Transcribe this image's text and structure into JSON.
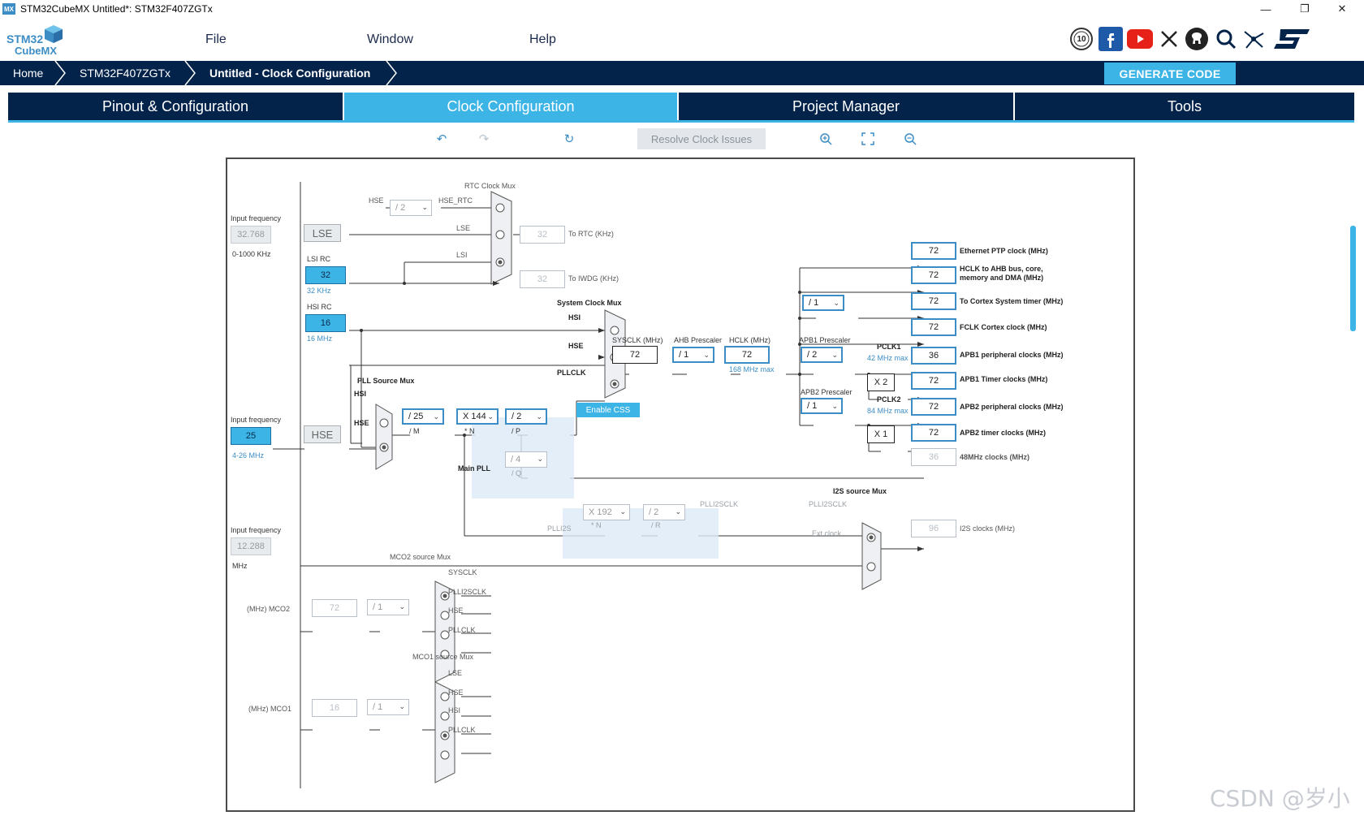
{
  "window": {
    "title": "STM32CubeMX Untitled*: STM32F407ZGTx",
    "app_icon": "MX"
  },
  "logo": {
    "line1": "STM32",
    "line2": "CubeMX"
  },
  "menu": {
    "file": "File",
    "window": "Window",
    "help": "Help"
  },
  "social_icons": [
    "anniversary-icon",
    "facebook-icon",
    "youtube-icon",
    "x-icon",
    "github-icon",
    "search-community-icon",
    "network-icon",
    "st-logo-icon"
  ],
  "anniversary_text": "10",
  "breadcrumb": {
    "home": "Home",
    "device": "STM32F407ZGTx",
    "page": "Untitled - Clock Configuration"
  },
  "generate_button": "GENERATE CODE",
  "tabs": {
    "pinout": "Pinout & Configuration",
    "clock": "Clock Configuration",
    "project": "Project Manager",
    "tools": "Tools"
  },
  "toolbar": {
    "resolve": "Resolve Clock Issues"
  },
  "clock": {
    "lse_input_label": "Input frequency",
    "lse_input_value": "32.768",
    "lse_range": "0-1000 KHz",
    "lse": "LSE",
    "lsi_rc": "LSI RC",
    "lsi_value": "32",
    "lsi_khz": "32 KHz",
    "hsi_rc": "HSI RC",
    "hsi_value": "16",
    "hsi_mhz": "16 MHz",
    "hse_input_label": "Input frequency",
    "hse_input_value": "25",
    "hse_range": "4-26 MHz",
    "hse": "HSE",
    "i2s_input_label": "Input frequency",
    "i2s_input_value": "12.288",
    "i2s_unit": "MHz",
    "rtc_mux": "RTC Clock Mux",
    "hse_rtc_in": "HSE",
    "hse_rtc_div": "/ 2",
    "hse_rtc": "HSE_RTC",
    "lse_line": "LSE",
    "lsi_line": "LSI",
    "rtc_value": "32",
    "to_rtc": "To RTC (KHz)",
    "iwdg_value": "32",
    "to_iwdg": "To IWDG (KHz)",
    "sys_mux": "System Clock Mux",
    "sys_hsi": "HSI",
    "sys_hse": "HSE",
    "sys_pllclk": "PLLCLK",
    "enable_css": "Enable CSS",
    "pll_src_mux": "PLL Source Mux",
    "pll_hsi": "HSI",
    "pll_hse": "HSE",
    "pll_m": "/ 25",
    "pll_m_label": "/ M",
    "pll_n": "X 144",
    "pll_n_label": "* N",
    "pll_p": "/ 2",
    "pll_p_label": "/ P",
    "pll_q": "/ 4",
    "pll_q_label": "/ Q",
    "main_pll": "Main PLL",
    "sysclk_label": "SYSCLK (MHz)",
    "sysclk": "72",
    "ahb_label": "AHB Prescaler",
    "ahb": "/ 1",
    "hclk_label": "HCLK (MHz)",
    "hclk": "72",
    "hclk_max": "168 MHz max",
    "apb1_label": "APB1 Prescaler",
    "apb1": "/ 2",
    "pclk1": "PCLK1",
    "pclk1_max": "42 MHz max",
    "apb2_label": "APB2 Prescaler",
    "apb2": "/ 1",
    "pclk2": "PCLK2",
    "pclk2_max": "84 MHz max",
    "cortex_div": "/ 1",
    "x2": "X 2",
    "x1": "X 1",
    "outputs": [
      {
        "value": "72",
        "label": "Ethernet PTP clock (MHz)"
      },
      {
        "value": "72",
        "label": "HCLK to AHB bus, core,",
        "label2": "memory and DMA (MHz)"
      },
      {
        "value": "72",
        "label": "To Cortex System timer (MHz)"
      },
      {
        "value": "72",
        "label": "FCLK Cortex clock (MHz)"
      },
      {
        "value": "36",
        "label": "APB1 peripheral clocks (MHz)"
      },
      {
        "value": "72",
        "label": "APB1 Timer clocks (MHz)"
      },
      {
        "value": "72",
        "label": "APB2 peripheral clocks (MHz)"
      },
      {
        "value": "72",
        "label": "APB2 timer clocks (MHz)"
      },
      {
        "value": "36",
        "label": "48MHz clocks (MHz)"
      }
    ],
    "plli2s_n": "X 192",
    "plli2s_n_label": "* N",
    "plli2s_r": "/ 2",
    "plli2s_r_label": "/ R",
    "plli2s": "PLLI2S",
    "plli2sclk": "PLLI2SCLK",
    "i2s_mux": "I2S source Mux",
    "i2s_plli2sclk": "PLLI2SCLK",
    "ext_clock": "Ext.clock",
    "i2s_value": "96",
    "i2s_clocks": "I2S clocks (MHz)",
    "mco2_mux": "MCO2 source Mux",
    "mco2_sysclk": "SYSCLK",
    "mco2_plli2s": "PLLI2SCLK",
    "mco2_hse": "HSE",
    "mco2_pllclk": "PLLCLK",
    "mco2_label": "(MHz) MCO2",
    "mco2_value": "72",
    "mco2_div": "/ 1",
    "mco1_mux": "MCO1 source Mux",
    "mco1_lse": "LSE",
    "mco1_hse": "HSE",
    "mco1_hsi": "HSI",
    "mco1_pllclk": "PLLCLK",
    "mco1_label": "(MHz) MCO1",
    "mco1_value": "16",
    "mco1_div": "/ 1"
  },
  "watermark": "CSDN @岁小",
  "colors": {
    "navy": "#03234b",
    "accent": "#3cb4e6",
    "line": "#333333"
  }
}
